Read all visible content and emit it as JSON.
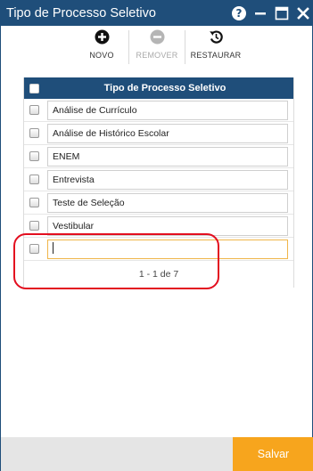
{
  "window": {
    "title": "Tipo de Processo Seletivo",
    "help_glyph": "?",
    "icons": [
      "help-icon",
      "minimize-icon",
      "maximize-icon",
      "close-icon"
    ]
  },
  "toolbar": {
    "novo_label": "NOVO",
    "remover_label": "REMOVER",
    "restaurar_label": "RESTAURAR",
    "remover_disabled": true
  },
  "grid": {
    "header_label": "Tipo de Processo Seletivo",
    "rows": [
      {
        "value": "Análise de Currículo"
      },
      {
        "value": "Análise de Histórico Escolar"
      },
      {
        "value": "ENEM"
      },
      {
        "value": "Entrevista"
      },
      {
        "value": "Teste de Seleção"
      },
      {
        "value": "Vestibular"
      }
    ],
    "new_row_value": "",
    "pager_text": "1 - 1 de 7"
  },
  "footer": {
    "save_label": "Salvar"
  },
  "colors": {
    "header_blue": "#1f4e7a",
    "save_orange": "#f7a51d",
    "highlight_red": "#e30e1f",
    "edit_border": "#f0b64a"
  }
}
